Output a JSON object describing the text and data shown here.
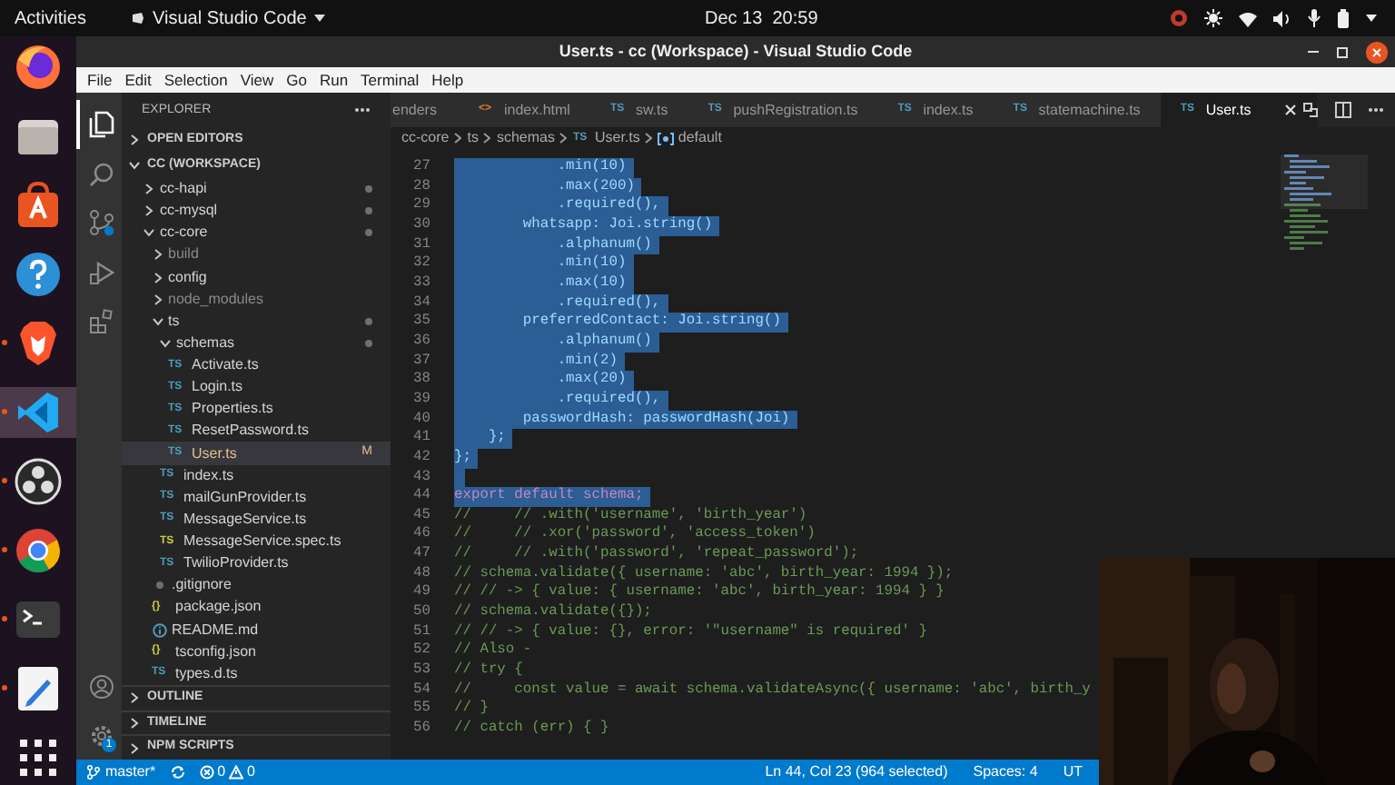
{
  "top_bar": {
    "activities": "Activities",
    "app_menu": "Visual Studio Code",
    "clock": "Dec 13  20:59"
  },
  "dock": [
    {
      "kind": "firefox",
      "running": false
    },
    {
      "kind": "files",
      "running": false
    },
    {
      "kind": "store",
      "running": false
    },
    {
      "kind": "help",
      "running": false
    },
    {
      "kind": "brave",
      "running": true
    },
    {
      "kind": "vscode",
      "running": true
    },
    {
      "kind": "obs",
      "running": true
    },
    {
      "kind": "chrome",
      "running": true
    },
    {
      "kind": "terminal",
      "running": true
    },
    {
      "kind": "editor",
      "running": true
    },
    {
      "kind": "grid",
      "running": false
    }
  ],
  "window": {
    "title": "User.ts - cc (Workspace) - Visual Studio Code"
  },
  "menu": [
    "File",
    "Edit",
    "Selection",
    "View",
    "Go",
    "Run",
    "Terminal",
    "Help"
  ],
  "activity_bar": [
    {
      "kind": "files",
      "selected": true
    },
    {
      "kind": "search",
      "selected": false
    },
    {
      "kind": "scm",
      "selected": false
    },
    {
      "kind": "run",
      "selected": false
    },
    {
      "kind": "extensions",
      "selected": false
    },
    {
      "kind": "account",
      "selected": false
    },
    {
      "kind": "settings",
      "selected": false,
      "badge": "1"
    }
  ],
  "explorer": {
    "title": "EXPLORER",
    "sections": [
      {
        "label": "OPEN EDITORS",
        "expanded": false
      },
      {
        "label": "CC (WORKSPACE)",
        "expanded": true,
        "tree": [
          {
            "label": "cc-hapi",
            "kind": "folder",
            "expanded": false,
            "modified": true,
            "dimmed": false,
            "selected": false
          },
          {
            "label": "cc-mysql",
            "kind": "folder",
            "expanded": false,
            "modified": true,
            "dimmed": false,
            "selected": false
          },
          {
            "label": "cc-core",
            "kind": "folder",
            "expanded": true,
            "modified": true,
            "dimmed": false,
            "selected": false,
            "children": [
              {
                "label": "build",
                "kind": "folder",
                "expanded": false,
                "modified": false,
                "dimmed": true,
                "selected": false
              },
              {
                "label": "config",
                "kind": "folder",
                "expanded": false,
                "modified": false,
                "dimmed": false,
                "selected": false
              },
              {
                "label": "node_modules",
                "kind": "folder",
                "expanded": false,
                "modified": false,
                "dimmed": true,
                "selected": false
              },
              {
                "label": "ts",
                "kind": "folder",
                "expanded": true,
                "modified": true,
                "dimmed": false,
                "selected": false,
                "children": [
                  {
                    "label": "schemas",
                    "kind": "folder",
                    "expanded": true,
                    "modified": true,
                    "dimmed": false,
                    "selected": false,
                    "children": [
                      {
                        "label": "Activate.ts",
                        "kind": "ts",
                        "icon_text": "TS",
                        "modified": false,
                        "dimmed": false,
                        "selected": false
                      },
                      {
                        "label": "Login.ts",
                        "kind": "ts",
                        "icon_text": "TS",
                        "modified": false,
                        "dimmed": false,
                        "selected": false
                      },
                      {
                        "label": "Properties.ts",
                        "kind": "ts",
                        "icon_text": "TS",
                        "modified": false,
                        "dimmed": false,
                        "selected": false
                      },
                      {
                        "label": "ResetPassword.ts",
                        "kind": "ts",
                        "icon_text": "TS",
                        "modified": false,
                        "dimmed": false,
                        "selected": false
                      },
                      {
                        "label": "User.ts",
                        "kind": "ts",
                        "icon_text": "TS",
                        "modified": true,
                        "badge": "M",
                        "dimmed": false,
                        "selected": true
                      }
                    ]
                  },
                  {
                    "label": "index.ts",
                    "kind": "ts",
                    "icon_text": "TS",
                    "modified": false,
                    "dimmed": false,
                    "selected": false
                  },
                  {
                    "label": "mailGunProvider.ts",
                    "kind": "ts",
                    "icon_text": "TS",
                    "modified": false,
                    "dimmed": false,
                    "selected": false
                  },
                  {
                    "label": "MessageService.ts",
                    "kind": "ts",
                    "icon_text": "TS",
                    "modified": false,
                    "dimmed": false,
                    "selected": false
                  },
                  {
                    "label": "MessageService.spec.ts",
                    "kind": "spec",
                    "icon_text": "TS",
                    "modified": false,
                    "dimmed": false,
                    "selected": false
                  },
                  {
                    "label": "TwilioProvider.ts",
                    "kind": "ts",
                    "icon_text": "TS",
                    "modified": false,
                    "dimmed": false,
                    "selected": false
                  }
                ]
              },
              {
                "label": ".gitignore",
                "kind": "git",
                "modified": false,
                "dimmed": false,
                "selected": false
              },
              {
                "label": "package.json",
                "kind": "json",
                "icon_text": "{}",
                "modified": false,
                "dimmed": false,
                "selected": false
              },
              {
                "label": "README.md",
                "kind": "md",
                "modified": false,
                "dimmed": false,
                "selected": false
              },
              {
                "label": "tsconfig.json",
                "kind": "json",
                "icon_text": "{}",
                "modified": false,
                "dimmed": false,
                "selected": false
              },
              {
                "label": "types.d.ts",
                "kind": "ts",
                "icon_text": "TS",
                "modified": false,
                "dimmed": false,
                "selected": false
              }
            ]
          }
        ]
      },
      {
        "label": "OUTLINE",
        "expanded": false
      },
      {
        "label": "TIMELINE",
        "expanded": false
      },
      {
        "label": "NPM SCRIPTS",
        "expanded": false
      }
    ]
  },
  "tabs": [
    {
      "label": "enders",
      "kind": "cut",
      "selected": false
    },
    {
      "label": "index.html",
      "kind": "html",
      "icon_text": "<>",
      "selected": false
    },
    {
      "label": "sw.ts",
      "kind": "ts",
      "icon_text": "TS",
      "selected": false
    },
    {
      "label": "pushRegistration.ts",
      "kind": "ts",
      "icon_text": "TS",
      "selected": false
    },
    {
      "label": "index.ts",
      "kind": "ts",
      "icon_text": "TS",
      "selected": false
    },
    {
      "label": "statemachine.ts",
      "kind": "ts",
      "icon_text": "TS",
      "selected": false
    },
    {
      "label": "User.ts",
      "kind": "ts",
      "icon_text": "TS",
      "selected": true
    }
  ],
  "breadcrumbs": [
    {
      "label": "cc-core",
      "kind": "folder"
    },
    {
      "label": "ts",
      "kind": "folder"
    },
    {
      "label": "schemas",
      "kind": "folder"
    },
    {
      "label": "User.ts",
      "kind": "file",
      "icon_text": "TS"
    },
    {
      "label": "default",
      "kind": "symbol"
    }
  ],
  "code_lines": [
    {
      "number": "27",
      "text": "            .min(10)",
      "kind": "code",
      "selected": true
    },
    {
      "number": "28",
      "text": "            .max(200)",
      "kind": "code",
      "selected": true
    },
    {
      "number": "29",
      "text": "            .required(),",
      "kind": "code",
      "selected": true
    },
    {
      "number": "30",
      "text": "        whatsapp: Joi.string()",
      "kind": "code",
      "selected": true
    },
    {
      "number": "31",
      "text": "            .alphanum()",
      "kind": "code",
      "selected": true
    },
    {
      "number": "32",
      "text": "            .min(10)",
      "kind": "code",
      "selected": true
    },
    {
      "number": "33",
      "text": "            .max(10)",
      "kind": "code",
      "selected": true
    },
    {
      "number": "34",
      "text": "            .required(),",
      "kind": "code",
      "selected": true
    },
    {
      "number": "35",
      "text": "        preferredContact: Joi.string()",
      "kind": "code",
      "selected": true
    },
    {
      "number": "36",
      "text": "            .alphanum()",
      "kind": "code",
      "selected": true
    },
    {
      "number": "37",
      "text": "            .min(2)",
      "kind": "code",
      "selected": true
    },
    {
      "number": "38",
      "text": "            .max(20)",
      "kind": "code",
      "selected": true
    },
    {
      "number": "39",
      "text": "            .required(),",
      "kind": "code",
      "selected": true
    },
    {
      "number": "40",
      "text": "        passwordHash: passwordHash(Joi)",
      "kind": "code",
      "selected": true
    },
    {
      "number": "41",
      "text": "    };",
      "kind": "code",
      "selected": true
    },
    {
      "number": "42",
      "text": "};",
      "kind": "code",
      "selected": true
    },
    {
      "number": "43",
      "kind": "code",
      "selected": true
    },
    {
      "number": "44",
      "text": "export default schema;",
      "kind": "keyword",
      "selected": true
    },
    {
      "number": "45",
      "text": "//     // .with('username', 'birth_year')",
      "kind": "comment",
      "selected": false
    },
    {
      "number": "46",
      "text": "//     // .xor('password', 'access_token')",
      "kind": "comment",
      "selected": false
    },
    {
      "number": "47",
      "text": "//     // .with('password', 'repeat_password');",
      "kind": "comment",
      "selected": false
    },
    {
      "number": "48",
      "text": "// schema.validate({ username: 'abc', birth_year: 1994 });",
      "kind": "comment",
      "selected": false
    },
    {
      "number": "49",
      "text": "// // -> { value: { username: 'abc', birth_year: 1994 } }",
      "kind": "comment",
      "selected": false
    },
    {
      "number": "50",
      "text": "// schema.validate({});",
      "kind": "comment",
      "selected": false
    },
    {
      "number": "51",
      "text": "// // -> { value: {}, error: '\"username\" is required' }",
      "kind": "comment",
      "selected": false
    },
    {
      "number": "52",
      "text": "// Also -",
      "kind": "comment",
      "selected": false
    },
    {
      "number": "53",
      "text": "// try {",
      "kind": "comment",
      "selected": false
    },
    {
      "number": "54",
      "text": "//     const value = await schema.validateAsync({ username: 'abc', birth_y",
      "kind": "comment",
      "selected": false
    },
    {
      "number": "55",
      "text": "// }",
      "kind": "comment",
      "selected": false
    },
    {
      "number": "56",
      "text": "// catch (err) { }",
      "kind": "comment",
      "selected": false
    }
  ],
  "status_bar": {
    "left": [
      {
        "kind": "branch",
        "text": "master*"
      },
      {
        "kind": "sync"
      },
      {
        "kind": "problems",
        "errors": "0",
        "warnings": "0"
      }
    ],
    "right": [
      {
        "text": "Ln 44, Col 23 (964 selected)"
      },
      {
        "text": "Spaces: 4"
      },
      {
        "text": "UT"
      }
    ]
  },
  "webcam": {
    "kind": "picture"
  }
}
